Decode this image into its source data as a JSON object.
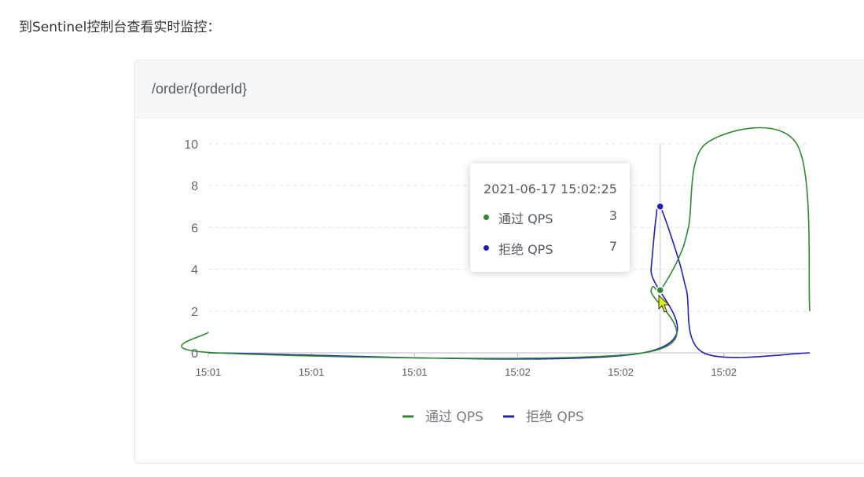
{
  "intro_text": "到Sentinel控制台查看实时监控：",
  "card": {
    "title": "/order/{orderId}"
  },
  "tooltip": {
    "time": "2021-06-17 15:02:25",
    "rows": [
      {
        "name": "通过 QPS",
        "value": "3",
        "color": "#2f8a2f"
      },
      {
        "name": "拒绝 QPS",
        "value": "7",
        "color": "#2020b8"
      }
    ]
  },
  "chart_data": {
    "type": "line",
    "x_tick_labels": [
      "15:01",
      "15:01",
      "15:01",
      "15:02",
      "15:02",
      "15:02"
    ],
    "x_tick_times": [
      0,
      10.2,
      20.4,
      30.6,
      40.8,
      51
    ],
    "y_ticks": [
      0,
      2,
      4,
      6,
      8,
      10
    ],
    "ylim": [
      0,
      10
    ],
    "xlim": [
      0,
      59.5
    ],
    "grid": "dashed-horizontal",
    "legend_position": "bottom-center",
    "crosshair_t": 44.7,
    "series": [
      {
        "name": "通过 QPS",
        "color": "#2f8a2f",
        "points": [
          [
            0,
            1
          ],
          [
            0.7,
            0
          ],
          [
            43.0,
            0
          ],
          [
            43.8,
            3
          ],
          [
            44.7,
            3
          ],
          [
            46.5,
            4.5
          ],
          [
            47.5,
            6
          ],
          [
            49.2,
            10
          ],
          [
            58.2,
            10
          ],
          [
            59.5,
            2
          ]
        ]
      },
      {
        "name": "拒绝 QPS",
        "color": "#2020b8",
        "points": [
          [
            0,
            0
          ],
          [
            43.0,
            0
          ],
          [
            43.8,
            4
          ],
          [
            44.3,
            6.5
          ],
          [
            44.7,
            7
          ],
          [
            46.5,
            4.5
          ],
          [
            47.3,
            3
          ],
          [
            49.0,
            0
          ],
          [
            59.5,
            0
          ]
        ]
      }
    ]
  }
}
